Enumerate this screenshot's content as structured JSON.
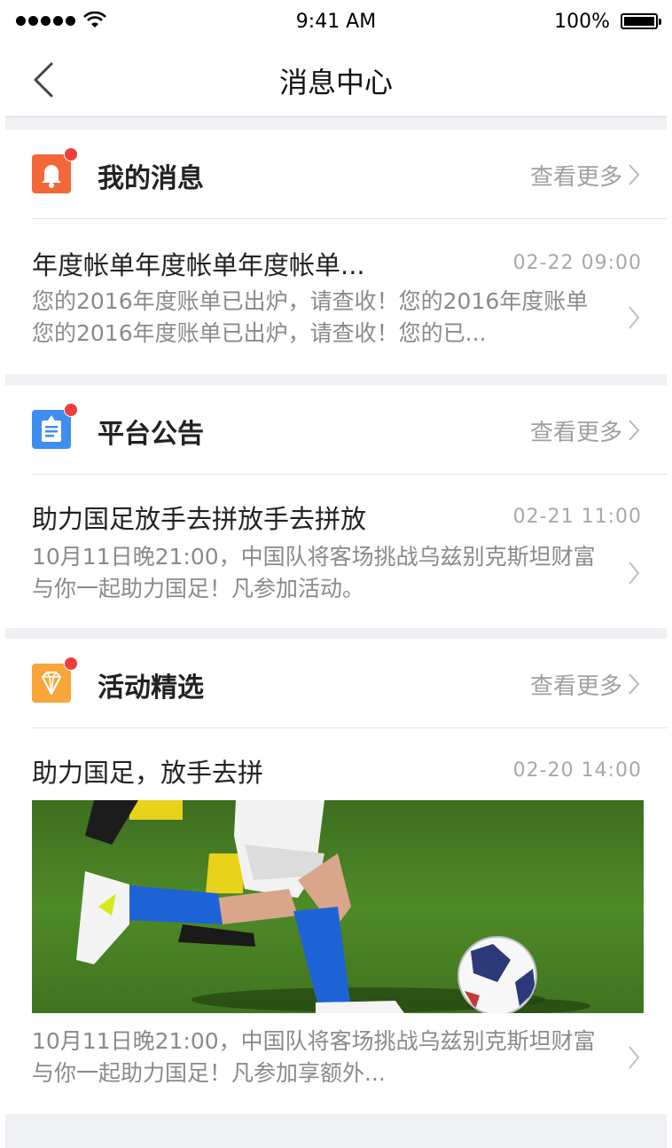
{
  "status_bar": {
    "time": "9:41 AM",
    "battery": "100%"
  },
  "nav": {
    "title": "消息中心"
  },
  "sections": [
    {
      "title": "我的消息",
      "more": "查看更多",
      "icon": "bell-icon",
      "color": "#f56738",
      "msg_title": "年度帐单年度帐单年度帐单...",
      "msg_time": "02-22 09:00",
      "msg_body": "您的2016年度账单已出炉，请查收！您的2016年度账单您的2016年度账单已出炉，请查收！您的已..."
    },
    {
      "title": "平台公告",
      "more": "查看更多",
      "icon": "notice-board-icon",
      "color": "#3e8ef0",
      "msg_title": "助力国足放手去拼放手去拼放",
      "msg_time": "02-21 11:00",
      "msg_body": "10月11日晚21:00，中国队将客场挑战乌兹别克斯坦财富与你一起助力国足！凡参加活动。"
    },
    {
      "title": "活动精选",
      "more": "查看更多",
      "icon": "diamond-icon",
      "color": "#f9a53a",
      "msg_title": "助力国足，放手去拼",
      "msg_time": "02-20 14:00",
      "msg_body": "10月11日晚21:00，中国队将客场挑战乌兹别克斯坦财富与你一起助力国足！凡参加享额外..."
    }
  ]
}
